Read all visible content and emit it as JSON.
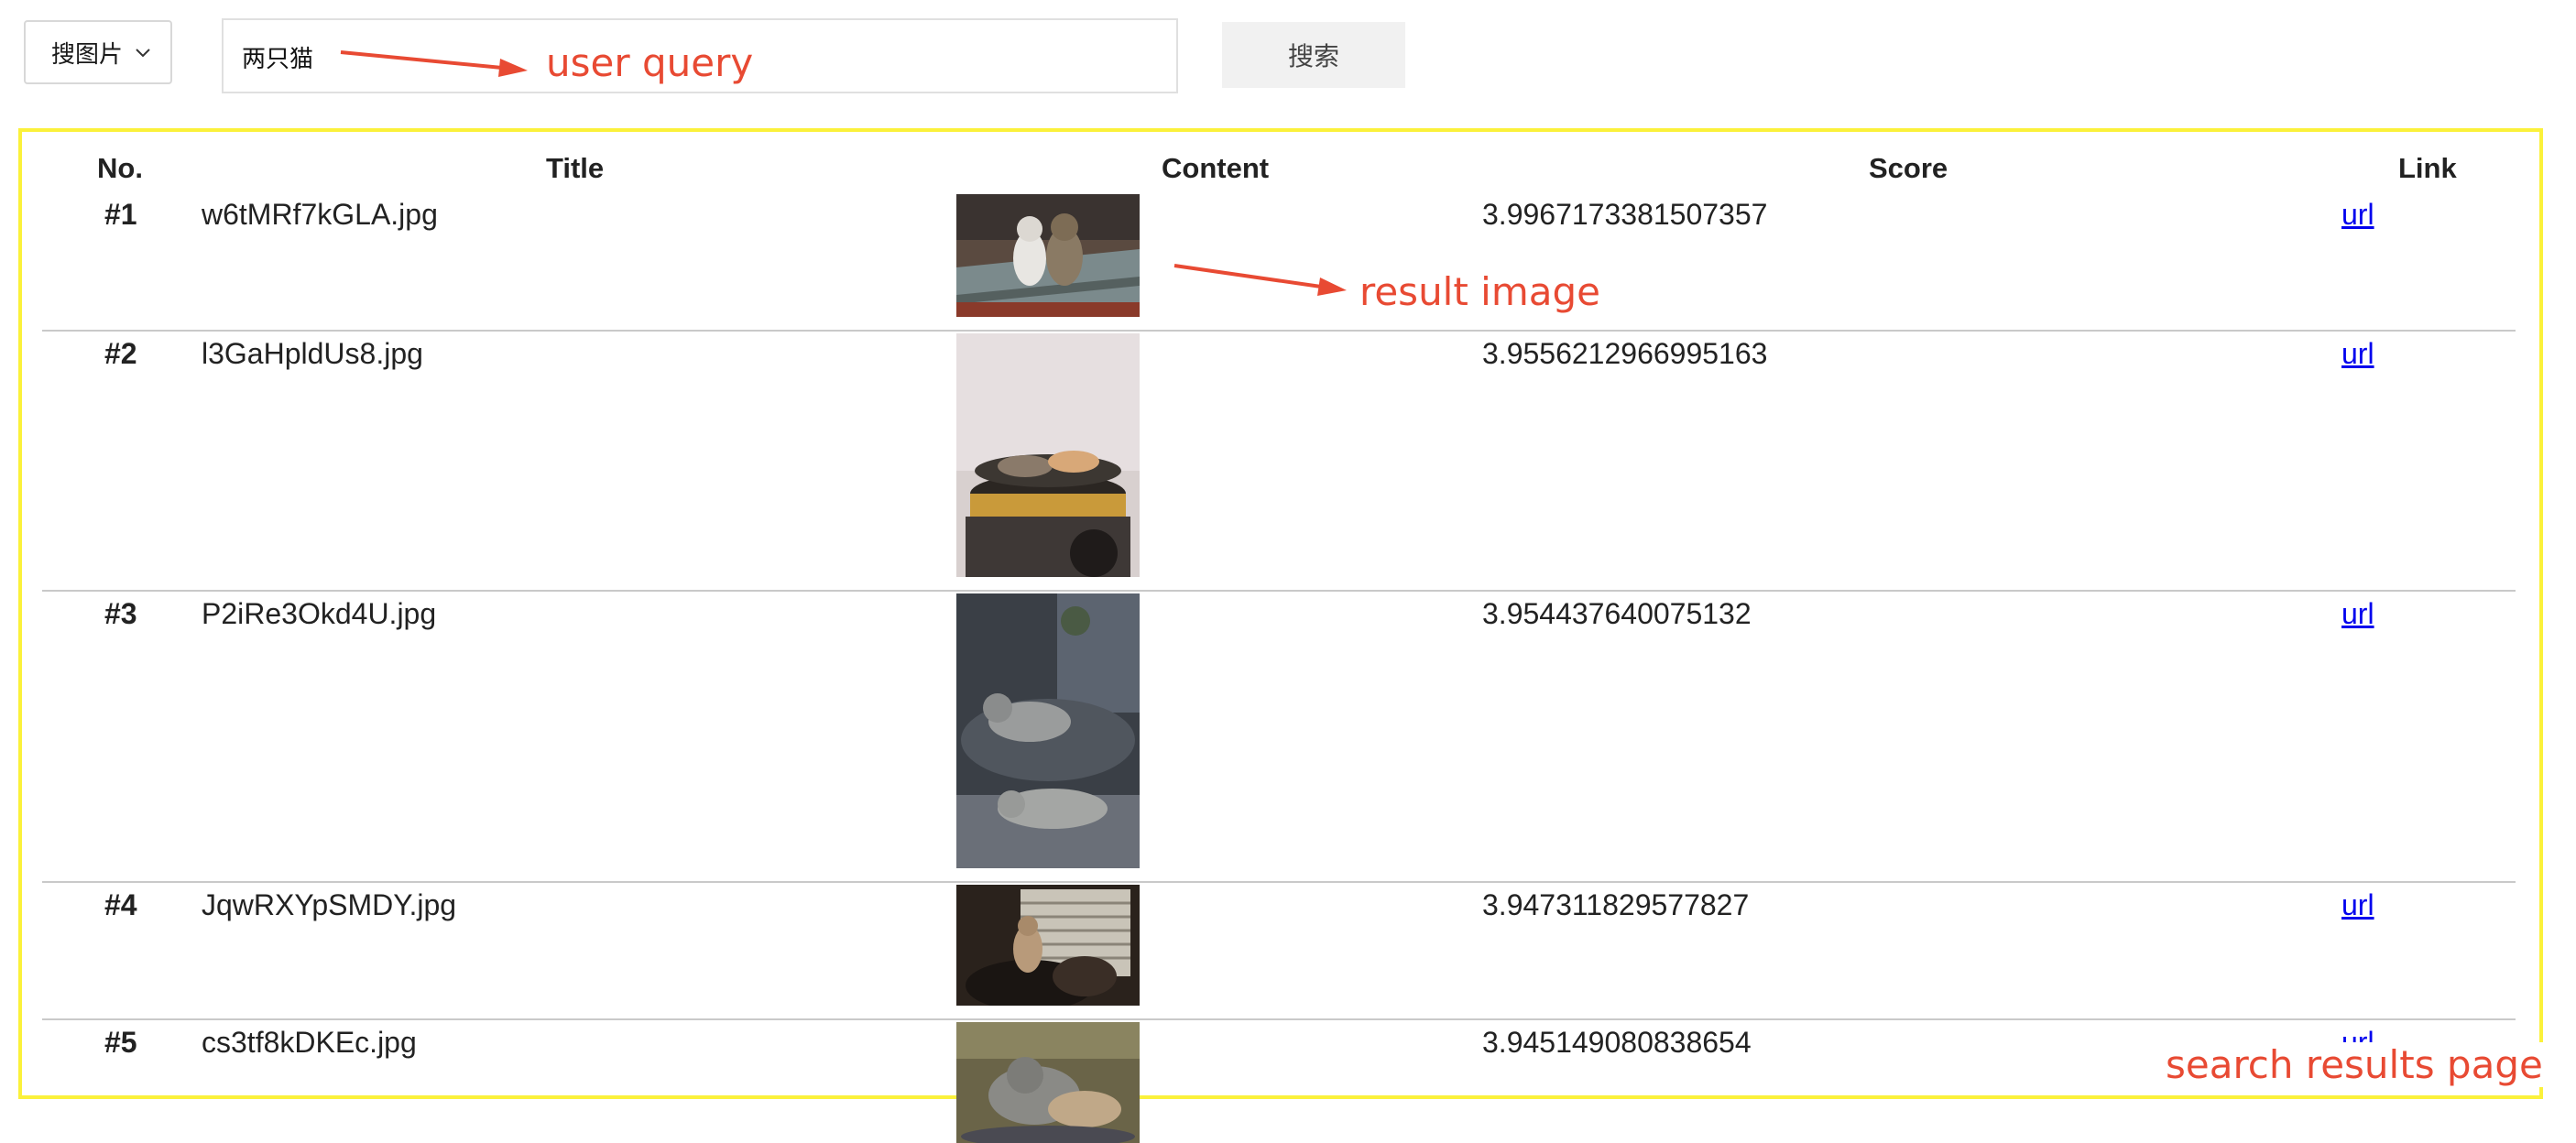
{
  "search_type": {
    "selected": "搜图片"
  },
  "query": {
    "value": "两只猫"
  },
  "search_button": "搜索",
  "annotations": {
    "user_query": "user query",
    "result_image": "result image",
    "results_page": "search results page"
  },
  "table": {
    "headers": {
      "no": "No.",
      "title": "Title",
      "content": "Content",
      "score": "Score",
      "link": "Link"
    },
    "rows": [
      {
        "no": "#1",
        "title": "w6tMRf7kGLA.jpg",
        "score": "3.9967173381507357",
        "link": "url",
        "image": "two cats sitting on wooden bench"
      },
      {
        "no": "#2",
        "title": "l3GaHpldUs8.jpg",
        "score": "3.9556212966995163",
        "link": "url",
        "image": "two cats lying on motorcycle seat"
      },
      {
        "no": "#3",
        "title": "P2iRe3Okd4U.jpg",
        "score": "3.954437640075132",
        "link": "url",
        "image": "two cats sleeping on grey bed"
      },
      {
        "no": "#4",
        "title": "JqwRXYpSMDY.jpg",
        "score": "3.947311829577827",
        "link": "url",
        "image": "cats near sunlit window"
      },
      {
        "no": "#5",
        "title": "cs3tf8kDKEc.jpg",
        "score": "3.945149080838654",
        "link": "url",
        "image": "two grey cats resting"
      }
    ]
  },
  "colors": {
    "annotation": "#e84a33",
    "frame": "#fbf13b",
    "link": "#0000ee"
  }
}
